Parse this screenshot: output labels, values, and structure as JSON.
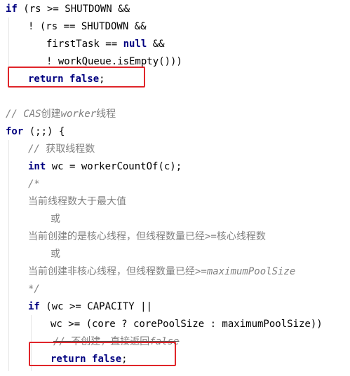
{
  "code": {
    "l1": {
      "kw": "if",
      "rest": " (rs >= SHUTDOWN &&"
    },
    "l2": {
      "text": "! (rs == SHUTDOWN &&"
    },
    "l3": {
      "a": "firstTask == ",
      "kw": "null",
      "b": " &&"
    },
    "l4": {
      "text": "! workQueue.isEmpty()))"
    },
    "l5": {
      "kw1": "return",
      "kw2": "false",
      "end": ";"
    },
    "l6": {
      "c1": "// CAS",
      "c2": "创建",
      "c3": "worker",
      "c4": "线程"
    },
    "l7": {
      "kw": "for",
      "rest": " (;;) {"
    },
    "l8": {
      "c1": "// ",
      "c2": "获取线程数"
    },
    "l9": {
      "kw": "int",
      "rest": " wc = workerCountOf(c);"
    },
    "l10": {
      "text": "/*"
    },
    "l11": {
      "text": "当前线程数大于最大值"
    },
    "l12": {
      "text": "或"
    },
    "l13": {
      "a": "当前创建的是核心线程，但线程数量已经",
      "b": ">=",
      "c": "核心线程数"
    },
    "l14": {
      "text": "或"
    },
    "l15": {
      "a": "当前创建非核心线程，但线程数量已经",
      "b": ">=maximumPoolSize"
    },
    "l16": {
      "text": "*/"
    },
    "l17": {
      "kw": "if",
      "rest": " (wc >= CAPACITY ||"
    },
    "l18": {
      "text": "wc >= (core ? corePoolSize : maximumPoolSize))"
    },
    "l19": {
      "a": "// ",
      "b": "不创建，直接返回",
      "c": "false"
    },
    "l20": {
      "kw1": "return",
      "kw2": "false",
      "end": ";"
    }
  },
  "colors": {
    "keyword": "#000080",
    "comment": "#808080",
    "highlight_box": "#e0252a",
    "background": "#ffffff"
  }
}
